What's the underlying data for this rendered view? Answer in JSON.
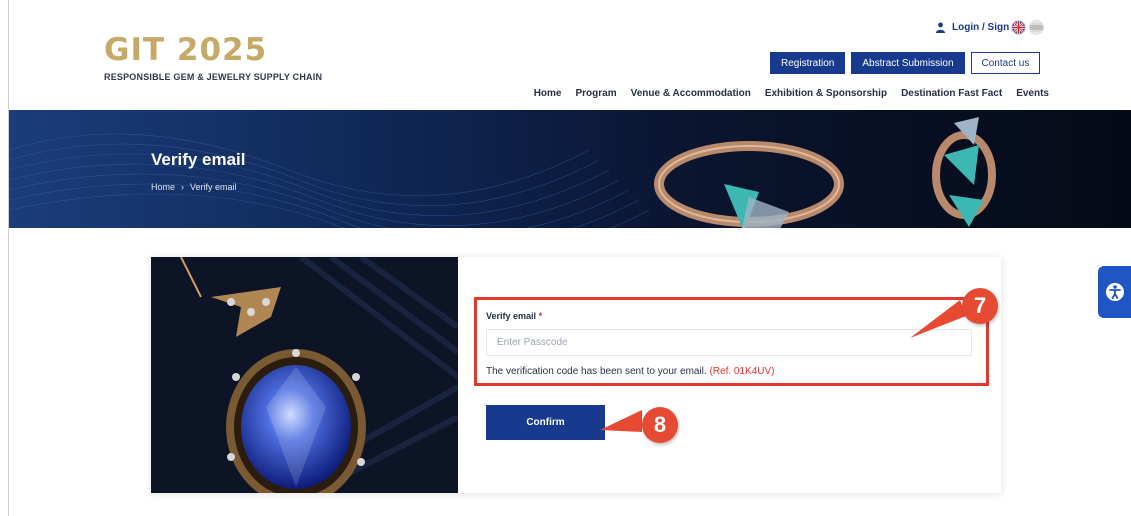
{
  "header": {
    "logo_title": "GIT 2025",
    "logo_tagline": "RESPONSIBLE GEM & JEWELRY SUPPLY CHAIN",
    "login_label": "Login / Sign up",
    "buttons": {
      "registration": "Registration",
      "abstract": "Abstract Submission",
      "contact": "Contact us"
    },
    "nav": [
      "Home",
      "Program",
      "Venue & Accommodation",
      "Exhibition & Sponsorship",
      "Destination Fast Fact",
      "Events"
    ]
  },
  "banner": {
    "title": "Verify email",
    "breadcrumb": {
      "home": "Home",
      "separator": "›",
      "current": "Verify email"
    }
  },
  "form": {
    "label": "Verify email",
    "required_mark": "*",
    "placeholder": "Enter Passcode",
    "note": "The verification code has been sent to your email.",
    "ref": "(Ref. 01K4UV)",
    "confirm_label": "Confirm"
  },
  "annotations": {
    "step7": "7",
    "step8": "8"
  },
  "colors": {
    "brand_blue": "#173a8e",
    "gold": "#c6a867",
    "annotation_red": "#e03a2e"
  },
  "icons": {
    "user": "user-icon",
    "flag_uk": "uk-flag-icon",
    "flag_th": "thai-flag-icon",
    "accessibility": "accessibility-icon"
  }
}
